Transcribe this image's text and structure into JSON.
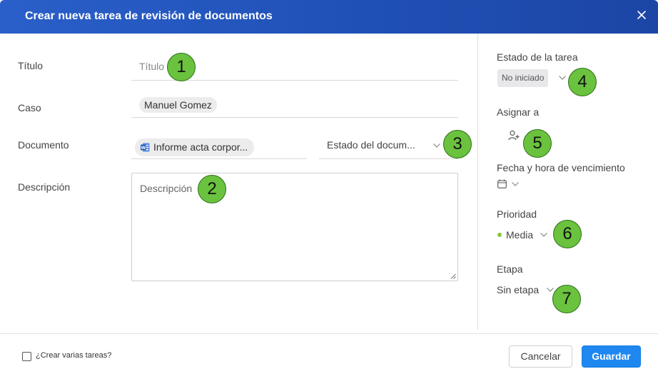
{
  "dialog": {
    "title": "Crear nueva tarea de revisión de documentos",
    "close_icon": "close-icon"
  },
  "form": {
    "title_label": "Título",
    "title_placeholder": "Título",
    "case_label": "Caso",
    "case_value": "Manuel Gomez",
    "document_label": "Documento",
    "document_value": "Informe acta corpor...",
    "document_icon": "word-document-icon",
    "document_status_placeholder": "Estado del docum...",
    "description_label": "Descripción",
    "description_placeholder": "Descripción"
  },
  "side": {
    "status_label": "Estado de la tarea",
    "status_value": "No iniciado",
    "assign_label": "Asignar a",
    "assign_icon": "add-user-icon",
    "due_label": "Fecha y hora de vencimiento",
    "due_icon": "calendar-icon",
    "priority_label": "Prioridad",
    "priority_value": "Media",
    "priority_color": "#8cc63f",
    "stage_label": "Etapa",
    "stage_value": "Sin etapa"
  },
  "annotations": [
    "1",
    "2",
    "3",
    "4",
    "5",
    "6",
    "7"
  ],
  "footer": {
    "multiple_tasks_label": "¿Crear varias tareas?",
    "cancel_label": "Cancelar",
    "save_label": "Guardar"
  },
  "colors": {
    "header": "#2356bd",
    "primary_button": "#1e88f0",
    "annotation_badge": "#6ac23e"
  }
}
